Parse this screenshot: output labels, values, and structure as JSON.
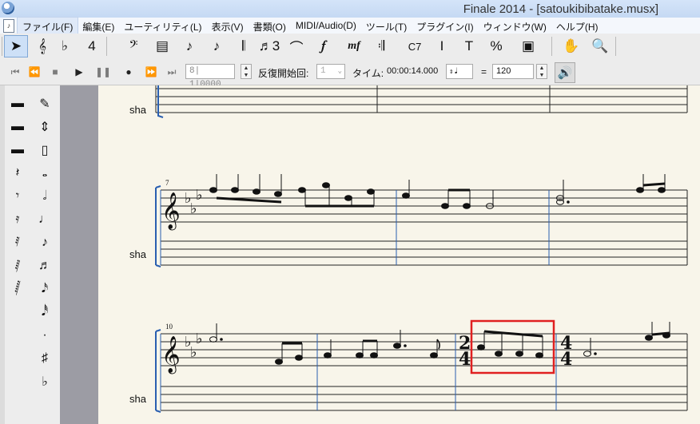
{
  "window": {
    "title": "Finale 2014 - [satoukibibatake.musx]",
    "icon": "finale-app-icon"
  },
  "menu": {
    "doc_icon_glyph": "♪",
    "items": [
      {
        "label": "ファイル(F)",
        "active": true
      },
      {
        "label": "編集(E)"
      },
      {
        "label": "ユーティリティ(L)"
      },
      {
        "label": "表示(V)"
      },
      {
        "label": "書類(O)"
      },
      {
        "label": "MIDI/Audio(D)"
      },
      {
        "label": "ツール(T)"
      },
      {
        "label": "プラグイン(I)"
      },
      {
        "label": "ウィンドウ(W)"
      },
      {
        "label": "ヘルプ(H)"
      }
    ]
  },
  "tools": [
    {
      "icon": "selection-tool-icon",
      "glyph": "➤",
      "selected": true
    },
    {
      "icon": "staff-tool-icon",
      "glyph": "𝄞"
    },
    {
      "icon": "key-signature-tool-icon",
      "glyph": "♭"
    },
    {
      "icon": "time-signature-tool-icon",
      "glyph": "4"
    },
    {
      "icon": "clef-tool-icon",
      "glyph": "𝄢"
    },
    {
      "icon": "measure-tool-icon",
      "glyph": "▤"
    },
    {
      "icon": "simple-entry-tool-icon",
      "glyph": "♪"
    },
    {
      "icon": "speedy-entry-tool-icon",
      "glyph": "♪"
    },
    {
      "icon": "tuplet-tool-icon",
      "glyph": "𝄃"
    },
    {
      "icon": "tuplet-3-tool-icon",
      "glyph": "♬3"
    },
    {
      "icon": "smart-shape-tool-icon",
      "glyph": "⌒"
    },
    {
      "icon": "articulation-tool-icon",
      "glyph": "𝆑"
    },
    {
      "icon": "expression-tool-icon",
      "glyph": "mf"
    },
    {
      "icon": "repeat-tool-icon",
      "glyph": "𝄇"
    },
    {
      "icon": "chord-tool-icon",
      "glyph": "C7"
    },
    {
      "icon": "lyrics-tool-icon",
      "glyph": "I"
    },
    {
      "icon": "text-tool-icon",
      "glyph": "T"
    },
    {
      "icon": "resize-tool-icon",
      "glyph": "%"
    },
    {
      "icon": "page-layout-tool-icon",
      "glyph": "▣"
    },
    {
      "icon": "hand-grabber-icon",
      "glyph": "✋"
    },
    {
      "icon": "zoom-icon",
      "glyph": "🔍"
    }
  ],
  "playback": {
    "buttons": [
      {
        "icon": "rewind-start-icon",
        "glyph": "⏮"
      },
      {
        "icon": "rewind-icon",
        "glyph": "⏪"
      },
      {
        "icon": "stop-icon",
        "glyph": "■"
      },
      {
        "icon": "play-icon",
        "glyph": "▶"
      },
      {
        "icon": "pause-icon",
        "glyph": "❚❚"
      },
      {
        "icon": "record-icon",
        "glyph": "●"
      },
      {
        "icon": "fast-forward-icon",
        "glyph": "⏩"
      },
      {
        "icon": "forward-end-icon",
        "glyph": "⏭"
      }
    ],
    "counter": "8| 1|0000",
    "repeat_start_label": "反復開始回:",
    "repeat_start_value": "1",
    "time_label": "タイム:",
    "time_value": "00:00:14.000",
    "tempo_equals": "=",
    "tempo_value": "120"
  },
  "palettes": {
    "left": [
      "▬",
      "▬",
      "▬",
      "𝄽",
      "𝄾",
      "𝄿",
      "𝅀",
      "𝅁",
      "𝅂"
    ],
    "right": [
      "✎",
      "⇕",
      "▯",
      "𝅝",
      "𝅗𝅥",
      "♩",
      "♪",
      "♬",
      "𝅘𝅥𝅯",
      "𝅘𝅥𝅰",
      "·",
      "♯",
      "♭"
    ]
  },
  "score": {
    "staff_name": "sha",
    "system2_measure_number": "7",
    "system3_measure_number": "10",
    "time_sig_2_4_top": "2",
    "time_sig_2_4_bottom": "4",
    "time_sig_4_4_top": "4",
    "time_sig_4_4_bottom": "4",
    "selection_color": "#e02020"
  }
}
